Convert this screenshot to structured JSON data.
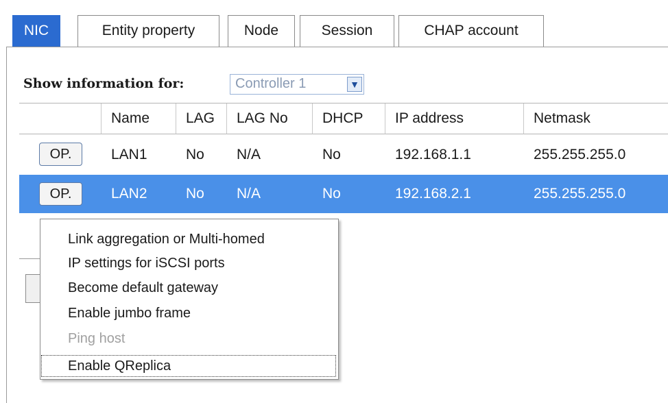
{
  "tabs": [
    {
      "label": "NIC",
      "active": true
    },
    {
      "label": "Entity property",
      "active": false
    },
    {
      "label": "Node",
      "active": false
    },
    {
      "label": "Session",
      "active": false
    },
    {
      "label": "CHAP account",
      "active": false
    }
  ],
  "filter": {
    "label": "Show information for:",
    "selected": "Controller 1",
    "arrow_icon": "chevron-down-icon"
  },
  "table": {
    "columns": [
      "",
      "Name",
      "LAG",
      "LAG No",
      "DHCP",
      "IP address",
      "Netmask"
    ],
    "rows": [
      {
        "op": "OP.",
        "name": "LAN1",
        "lag": "No",
        "lag_no": "N/A",
        "dhcp": "No",
        "ip": "192.168.1.1",
        "netmask": "255.255.255.0",
        "selected": false
      },
      {
        "op": "OP.",
        "name": "LAN2",
        "lag": "No",
        "lag_no": "N/A",
        "dhcp": "No",
        "ip": "192.168.2.1",
        "netmask": "255.255.255.0",
        "selected": true
      }
    ]
  },
  "context_menu": {
    "items": [
      {
        "label": "Link aggregation or Multi-homed",
        "enabled": true
      },
      {
        "label": "IP settings for iSCSI ports",
        "enabled": true
      },
      {
        "label": "Become default gateway",
        "enabled": true
      },
      {
        "label": "Enable jumbo frame",
        "enabled": true
      },
      {
        "label": "Ping host",
        "enabled": false
      },
      {
        "label": "Enable QReplica",
        "enabled": true,
        "focused": true
      }
    ]
  },
  "colors": {
    "tab_active": "#2b6bd0",
    "row_selected": "#4a90e8",
    "disabled_text": "#a0a0a0"
  }
}
